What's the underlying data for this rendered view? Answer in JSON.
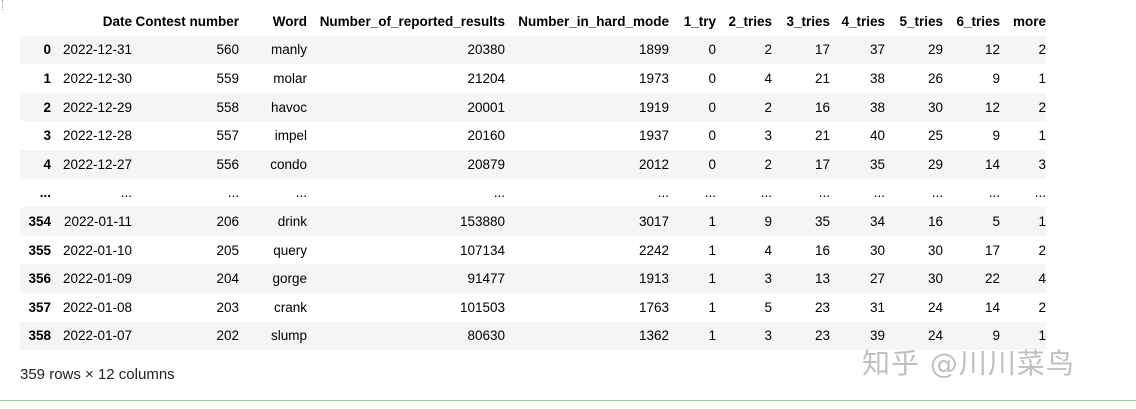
{
  "table": {
    "columns": [
      "",
      "Date",
      "Contest number",
      "Word",
      "Number_of_reported_results",
      "Number_in_hard_mode",
      "1_try",
      "2_tries",
      "3_tries",
      "4_tries",
      "5_tries",
      "6_tries",
      "more"
    ],
    "rows": [
      [
        "0",
        "2022-12-31",
        "560",
        "manly",
        "20380",
        "1899",
        "0",
        "2",
        "17",
        "37",
        "29",
        "12",
        "2"
      ],
      [
        "1",
        "2022-12-30",
        "559",
        "molar",
        "21204",
        "1973",
        "0",
        "4",
        "21",
        "38",
        "26",
        "9",
        "1"
      ],
      [
        "2",
        "2022-12-29",
        "558",
        "havoc",
        "20001",
        "1919",
        "0",
        "2",
        "16",
        "38",
        "30",
        "12",
        "2"
      ],
      [
        "3",
        "2022-12-28",
        "557",
        "impel",
        "20160",
        "1937",
        "0",
        "3",
        "21",
        "40",
        "25",
        "9",
        "1"
      ],
      [
        "4",
        "2022-12-27",
        "556",
        "condo",
        "20879",
        "2012",
        "0",
        "2",
        "17",
        "35",
        "29",
        "14",
        "3"
      ],
      [
        "...",
        "...",
        "...",
        "...",
        "...",
        "...",
        "...",
        "...",
        "...",
        "...",
        "...",
        "...",
        "..."
      ],
      [
        "354",
        "2022-01-11",
        "206",
        "drink",
        "153880",
        "3017",
        "1",
        "9",
        "35",
        "34",
        "16",
        "5",
        "1"
      ],
      [
        "355",
        "2022-01-10",
        "205",
        "query",
        "107134",
        "2242",
        "1",
        "4",
        "16",
        "30",
        "30",
        "17",
        "2"
      ],
      [
        "356",
        "2022-01-09",
        "204",
        "gorge",
        "91477",
        "1913",
        "1",
        "3",
        "13",
        "27",
        "30",
        "22",
        "4"
      ],
      [
        "357",
        "2022-01-08",
        "203",
        "crank",
        "101503",
        "1763",
        "1",
        "5",
        "23",
        "31",
        "24",
        "14",
        "2"
      ],
      [
        "358",
        "2022-01-07",
        "202",
        "slump",
        "80630",
        "1362",
        "1",
        "3",
        "23",
        "39",
        "24",
        "9",
        "1"
      ]
    ]
  },
  "shape_info": "359 rows × 12 columns",
  "watermark": "知乎 @川川菜鸟"
}
